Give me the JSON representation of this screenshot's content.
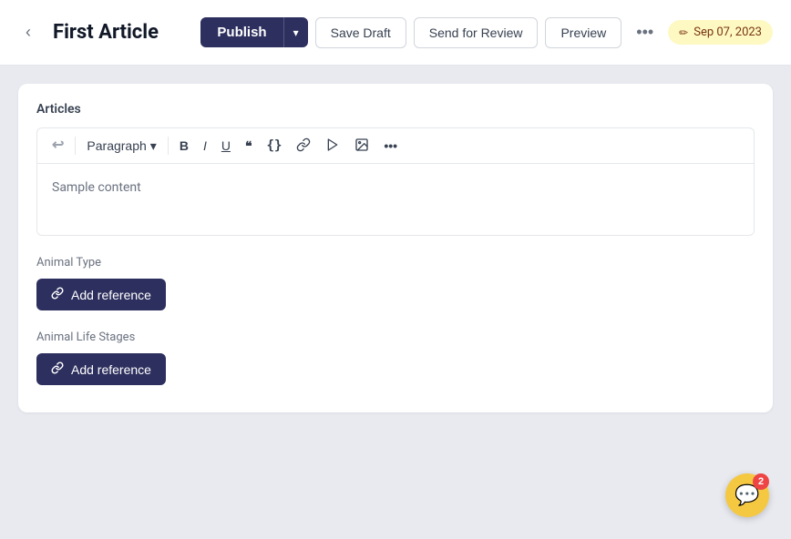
{
  "header": {
    "back_label": "‹",
    "title": "First Article",
    "publish_label": "Publish",
    "publish_dropdown_icon": "▾",
    "save_draft_label": "Save Draft",
    "send_review_label": "Send for Review",
    "preview_label": "Preview",
    "more_icon": "•••",
    "date_label": "Sep 07, 2023",
    "pencil_icon": "✏"
  },
  "editor": {
    "section_label": "Articles",
    "undo_icon": "↩",
    "paragraph_label": "Paragraph",
    "dropdown_icon": "▾",
    "bold_label": "B",
    "italic_label": "I",
    "underline_label": "U",
    "quote_label": "\"\"",
    "code_label": "{}",
    "link_label": "🔗",
    "video_label": "▶",
    "image_label": "⬜",
    "more_label": "•••",
    "sample_content": "Sample content"
  },
  "animal_type": {
    "label": "Animal Type",
    "add_ref_label": "Add reference",
    "link_icon": "🔗"
  },
  "animal_life_stages": {
    "label": "Animal Life Stages",
    "add_ref_label": "Add reference",
    "link_icon": "🔗"
  },
  "chat": {
    "badge_count": "2"
  }
}
